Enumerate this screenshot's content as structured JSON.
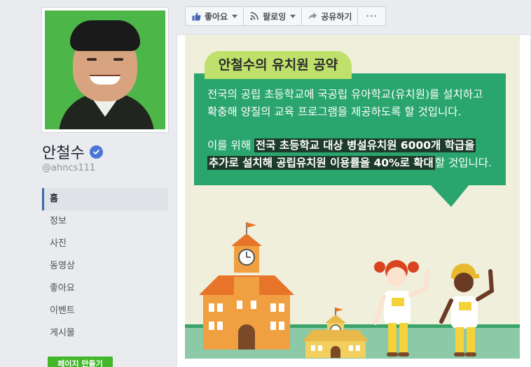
{
  "profile": {
    "name": "안철수",
    "username": "@ahncs111"
  },
  "nav": {
    "items": [
      "홈",
      "정보",
      "사진",
      "동영상",
      "좋아요",
      "이벤트",
      "게시물"
    ],
    "active_index": 0
  },
  "create_page_label": "페이지 만들기",
  "actions": {
    "like_label": "좋아요",
    "follow_label": "팔로잉",
    "share_label": "공유하기",
    "more_label": "···"
  },
  "post": {
    "image_title": "안철수의 유치원 공약",
    "line1": "전국의 공립 초등학교에 국공립 유아학교(유치원)를 설치하고",
    "line2": "확충해 양질의 교육 프로그램을 제공하도록 할 것입니다.",
    "line3_pre": "이를 위해 ",
    "line3_hl": "전국 초등학교 대상 병설유치원 6000개 학급을",
    "line4_hl": "추가로 설치해 공립유치원 이용률을 40%로 확대",
    "line4_post": "할 것입니다."
  },
  "colors": {
    "fb_blue": "#4267b2",
    "verified": "#4a76d6",
    "create_button": "#42b72a",
    "bubble_green": "#2aa56e",
    "title_pill": "#bfe06b"
  },
  "icons": [
    "verified-icon",
    "thumbs-up-icon",
    "rss-icon",
    "share-arrow-icon",
    "more-icon"
  ]
}
